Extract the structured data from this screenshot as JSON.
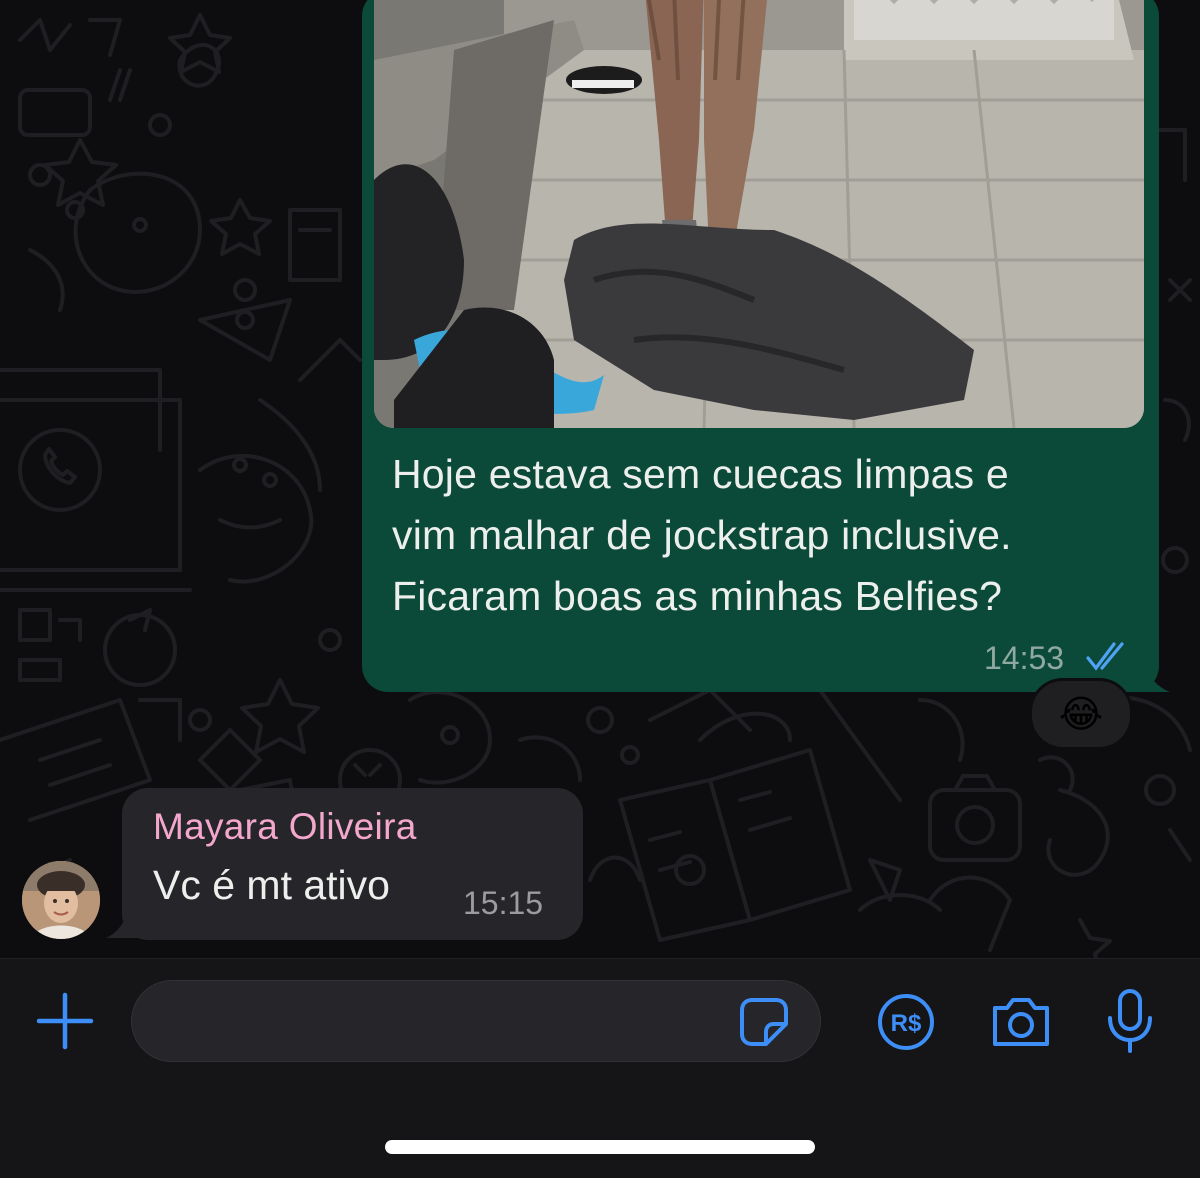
{
  "outgoing_message": {
    "text_lines": [
      "Hoje estava sem cuecas limpas e",
      "vim malhar de jockstrap inclusive.",
      "Ficaram boas as minhas Belfies?"
    ],
    "time": "14:53",
    "status": "read",
    "reaction": "😂"
  },
  "incoming_message": {
    "sender": "Mayara Oliveira",
    "text": "Vc é mt ativo",
    "time": "15:15"
  },
  "input_bar": {
    "placeholder": "",
    "icons": [
      "plus-icon",
      "sticker-icon",
      "payment-icon",
      "camera-icon",
      "microphone-icon"
    ],
    "payment_label": "R$"
  },
  "colors": {
    "accent": "#3d8ef7",
    "outgoing_bubble": "#0b4a38",
    "incoming_bubble": "#26262a",
    "sender_name": "#f4a7cd"
  }
}
